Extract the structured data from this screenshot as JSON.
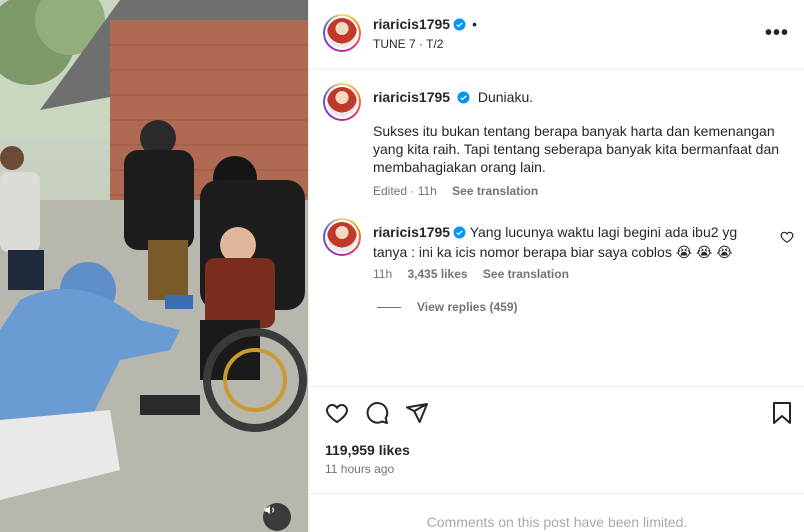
{
  "post": {
    "username": "riaricis1795",
    "audio_label": "TUNE 7 · T/2",
    "more_label": "•••",
    "dot": "•"
  },
  "caption": {
    "username": "riaricis1795",
    "lead": "Duniaku.",
    "body": "Sukses itu bukan tentang berapa banyak harta dan kemenangan yang kita raih. Tapi tentang seberapa banyak kita bermanfaat dan membahagiakan orang lain.",
    "edited": "Edited · 11h",
    "see_translation": "See translation"
  },
  "comment": {
    "username": "riaricis1795",
    "text": "Yang lucunya waktu lagi begini ada ibu2 yg tanya : ini ka icis nomor berapa biar saya coblos 😭 😭 😭",
    "time": "11h",
    "likes": "3,435 likes",
    "see_translation": "See translation",
    "view_replies": "View replies (459)"
  },
  "stats": {
    "likes": "119,959 likes",
    "time_ago": "11 hours ago"
  },
  "footer": {
    "notice": "Comments on this post have been limited."
  },
  "colors": {
    "verified": "#0095f6",
    "muted_text": "#737373",
    "border": "#efefef"
  },
  "icons": {
    "like": "heart-icon",
    "comment": "comment-icon",
    "share": "paper-plane-icon",
    "save": "bookmark-icon",
    "mute": "speaker-icon",
    "more": "more-dots-icon"
  }
}
